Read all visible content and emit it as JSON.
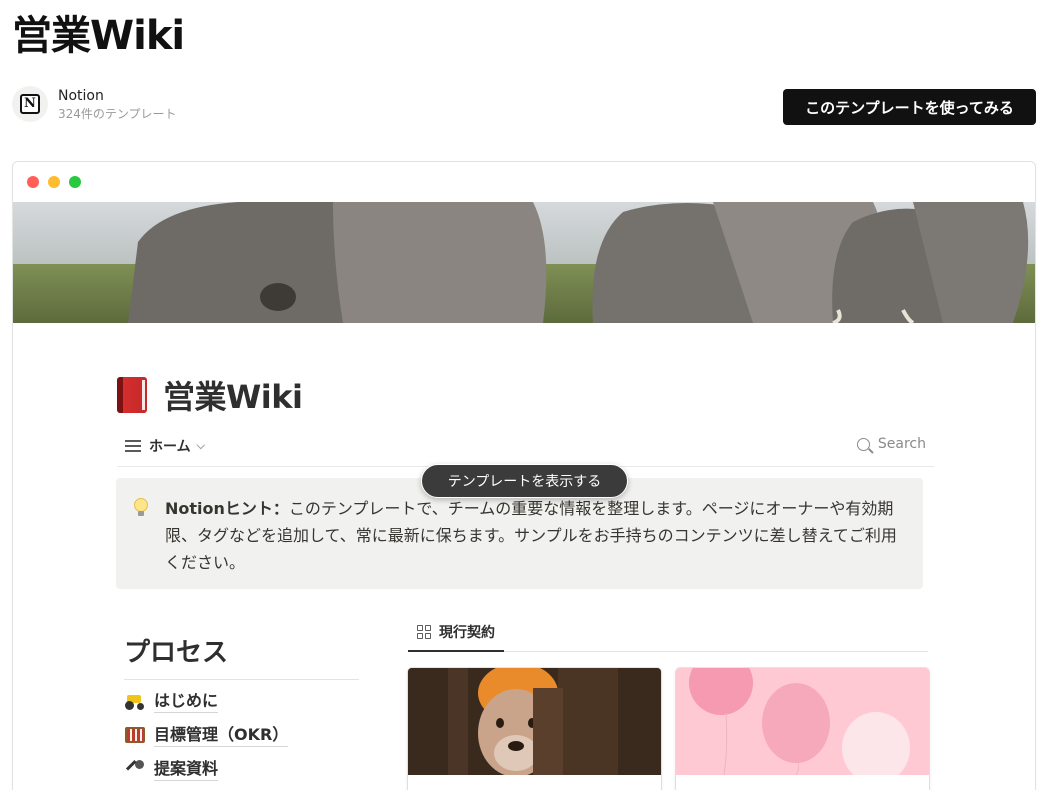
{
  "page": {
    "title": "営業Wiki"
  },
  "author": {
    "name": "Notion",
    "template_count": "324件のテンプレート",
    "logo_glyph": "N"
  },
  "cta": {
    "use_template_label": "このテンプレートを使ってみる"
  },
  "preview": {
    "doc_title": "営業Wiki",
    "view": {
      "label": "ホーム",
      "chevron": "⌵"
    },
    "search_label": "Search",
    "tooltip_label": "テンプレートを表示する",
    "callout": {
      "bold_prefix": "Notionヒント：",
      "text": "このテンプレートで、チームの重要な情報を整理します。ページにオーナーや有効期限、タグなどを追加して、常に最新に保ちます。サンプルをお手持ちのコンテンツに差し替えてご利用ください。"
    },
    "process": {
      "title": "プロセス",
      "items": [
        {
          "label": "はじめに",
          "icon": "tractor-icon"
        },
        {
          "label": "目標管理（OKR）",
          "icon": "abacus-icon"
        },
        {
          "label": "提案資料",
          "icon": "microphone-icon"
        }
      ]
    },
    "database": {
      "tab_label": "現行契約"
    }
  },
  "colors": {
    "cta_bg": "#111111",
    "callout_bg": "#f1f1ef",
    "tooltip_bg": "#3b3b3b",
    "dot_red": "#ff5f57",
    "dot_yellow": "#febc2e",
    "dot_green": "#28c840"
  }
}
